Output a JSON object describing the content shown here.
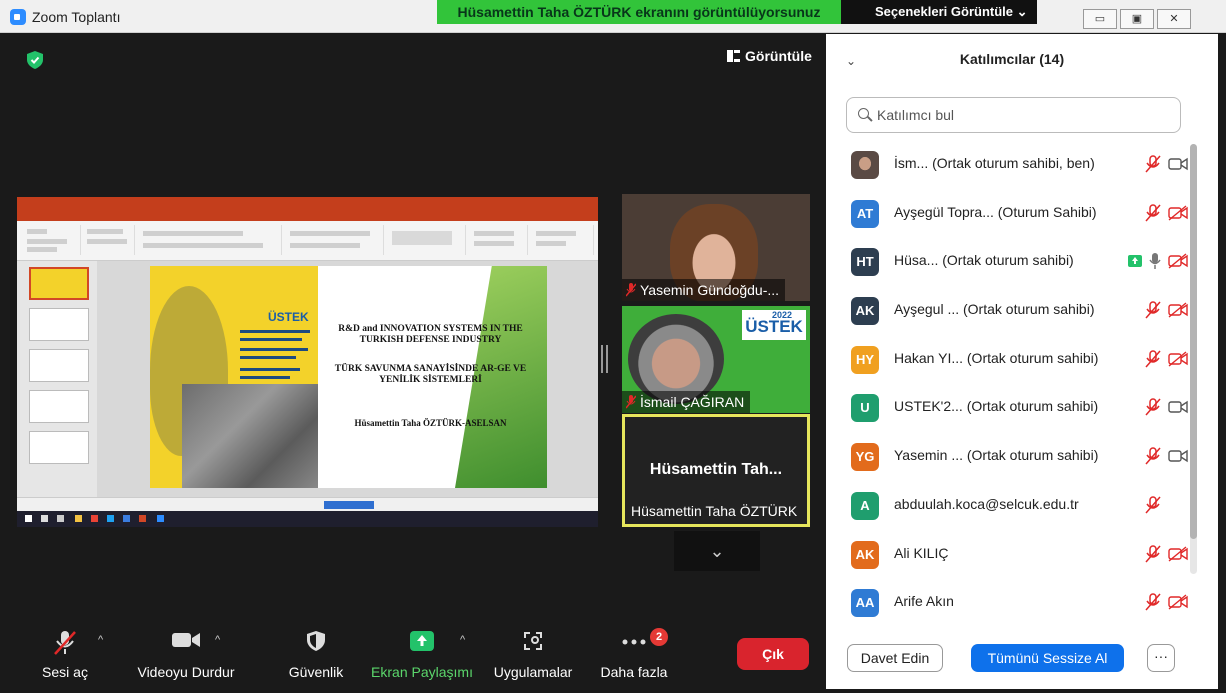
{
  "window": {
    "title": "Zoom Toplantı",
    "minimize": "▭",
    "maximize": "▣",
    "close": "✕"
  },
  "banner": {
    "sharing_text": "Hüsamettin Taha ÖZTÜRK ekranını görüntülüyorsunuz",
    "view_options": "Seçenekleri Görüntüle ⌄"
  },
  "meeting": {
    "view_label": "Görüntüle"
  },
  "slide": {
    "logo_text": "ÜSTEK",
    "title_en": "R&D and INNOVATION SYSTEMS IN THE TURKISH DEFENSE INDUSTRY",
    "title_tr": "TÜRK SAVUNMA SANAYİSİNDE AR-GE VE YENİLİK SİSTEMLERİ",
    "author": "Hüsamettin Taha ÖZTÜRK-ASELSAN"
  },
  "tiles": [
    {
      "name": "Yasemin Gündoğdu-..."
    },
    {
      "name": "İsmail ÇAĞIRAN",
      "logo": "ÜSTEK",
      "logo_year": "2022"
    },
    {
      "big_name": "Hüsamettin Tah...",
      "name": "Hüsamettin Taha ÖZTÜRK"
    }
  ],
  "toolbar": {
    "audio": "Sesi aç",
    "video": "Videoyu Durdur",
    "security": "Güvenlik",
    "share": "Ekran Paylaşımı",
    "apps": "Uygulamalar",
    "more": "Daha fazla",
    "more_badge": "2",
    "exit": "Çık"
  },
  "panel": {
    "title": "Katılımcılar (14)",
    "search_placeholder": "Katılımcı bul",
    "invite": "Davet Edin",
    "mute_all": "Tümünü Sessize Al",
    "more": "···",
    "participants": [
      {
        "initials": "",
        "photo": true,
        "color": "#777777",
        "name": "İsm...  (Ortak oturum sahibi, ben)",
        "mic": "muted",
        "video": "on"
      },
      {
        "initials": "AT",
        "color": "#2f7bd4",
        "name": "Ayşegül Topra...  (Oturum Sahibi)",
        "mic": "muted",
        "video": "off"
      },
      {
        "initials": "HT",
        "color": "#2d3e50",
        "name": "Hüsa...  (Ortak oturum sahibi)",
        "mic": "on",
        "video": "off",
        "sharing": true
      },
      {
        "initials": "AK",
        "color": "#2d3e50",
        "name": "Ayşegul ...  (Ortak oturum sahibi)",
        "mic": "muted",
        "video": "off"
      },
      {
        "initials": "HY",
        "color": "#f0a020",
        "name": "Hakan YI...  (Ortak oturum sahibi)",
        "mic": "muted",
        "video": "off"
      },
      {
        "initials": "U",
        "color": "#1f9e6e",
        "name": "USTEK'2...  (Ortak oturum sahibi)",
        "mic": "muted",
        "video": "on"
      },
      {
        "initials": "YG",
        "color": "#e26b1c",
        "name": "Yasemin ...  (Ortak oturum sahibi)",
        "mic": "muted",
        "video": "on"
      },
      {
        "initials": "A",
        "color": "#1f9e6e",
        "name": "abduulah.koca@selcuk.edu.tr",
        "mic": "muted",
        "video": "none"
      },
      {
        "initials": "AK",
        "color": "#e26b1c",
        "name": "Ali KILIÇ",
        "mic": "muted",
        "video": "off"
      },
      {
        "initials": "AA",
        "color": "#2f7bd4",
        "name": "Arife Akın",
        "mic": "muted",
        "video": "off"
      }
    ]
  },
  "colors": {
    "accent": "#0e71eb",
    "exit": "#d9242d",
    "share_green": "#23c26a",
    "muted_red": "#e02828",
    "banner_green": "#32c43a"
  }
}
